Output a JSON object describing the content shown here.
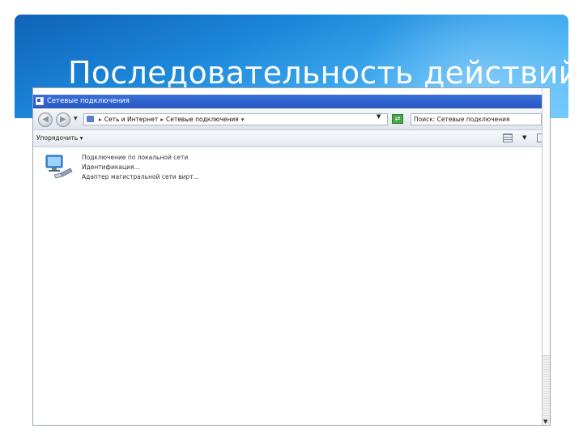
{
  "slide": {
    "title": "Последовательность действий"
  },
  "window": {
    "title": "Сетевые подключения",
    "nav": {
      "back_icon": "back-arrow-icon",
      "forward_icon": "forward-arrow-icon"
    },
    "address": {
      "segments": [
        "Сеть и Интернет",
        "Сетевые подключения"
      ],
      "separator": "▸"
    },
    "search_placeholder": "Поиск: Сетевые подключения",
    "toolbar": {
      "organize_label": "Упорядочить"
    },
    "connection": {
      "name": "Подключение по локальной сети",
      "status": "Идентификация...",
      "adapter": "Адаптер магистральной сети вирт..."
    }
  },
  "colors": {
    "banner_dark": "#0f62b8",
    "banner_light": "#6cc8fb",
    "titlebar": "#2858c4",
    "go_button": "#48a646"
  }
}
